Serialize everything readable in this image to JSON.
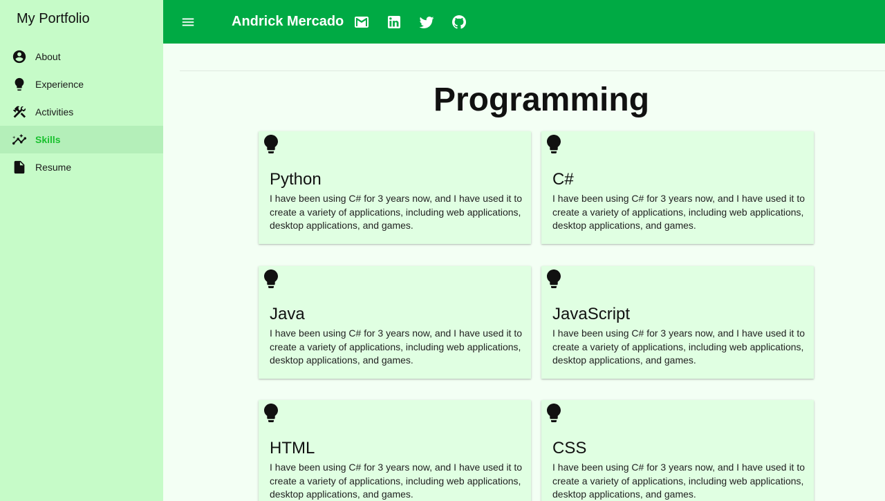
{
  "sidebar": {
    "brand": "My Portfolio",
    "items": [
      {
        "label": "About",
        "icon": "account-circle-icon"
      },
      {
        "label": "Experience",
        "icon": "lightbulb-icon"
      },
      {
        "label": "Activities",
        "icon": "tools-icon"
      },
      {
        "label": "Skills",
        "icon": "insights-icon",
        "active": true
      },
      {
        "label": "Resume",
        "icon": "document-icon"
      }
    ]
  },
  "appbar": {
    "title": "Andrick Mercado",
    "icons": [
      "menu-icon",
      "mail-icon",
      "linkedin-icon",
      "twitter-icon",
      "github-icon"
    ]
  },
  "section": {
    "title": "Programming",
    "cards": [
      {
        "title": "Python",
        "description": "I have been using C# for 3 years now, and I have used it to create a variety of applications, including web applications, desktop applications, and games."
      },
      {
        "title": "C#",
        "description": "I have been using C# for 3 years now, and I have used it to create a variety of applications, including web applications, desktop applications, and games."
      },
      {
        "title": "Java",
        "description": "I have been using C# for 3 years now, and I have used it to create a variety of applications, including web applications, desktop applications, and games."
      },
      {
        "title": "JavaScript",
        "description": "I have been using C# for 3 years now, and I have used it to create a variety of applications, including web applications, desktop applications, and games."
      },
      {
        "title": "HTML",
        "description": "I have been using C# for 3 years now, and I have used it to create a variety of applications, including web applications, desktop applications, and games."
      },
      {
        "title": "CSS",
        "description": "I have been using C# for 3 years now, and I have used it to create a variety of applications, including web applications, desktop applications, and games."
      }
    ]
  },
  "colors": {
    "appbar": "#00aa44",
    "sidebar": "#c6fbc8",
    "sidebar_active": "#b4efb9",
    "active_text": "#19c12e",
    "card": "#e0ffe2",
    "page": "#f3fff4"
  }
}
